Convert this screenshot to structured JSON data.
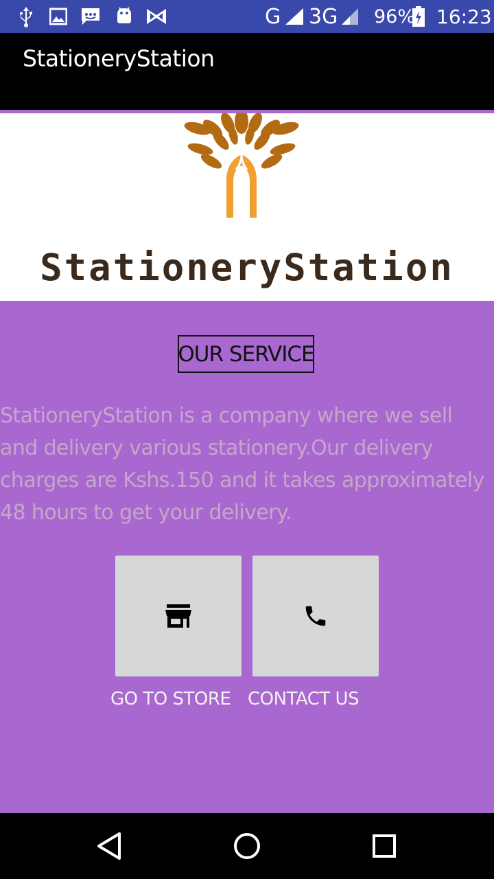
{
  "status_bar": {
    "network": "G",
    "network2": "3G",
    "battery": "96%",
    "time": "16:23",
    "icons": [
      "usb-icon",
      "image-icon",
      "message-icon",
      "android-icon",
      "bowtie-icon",
      "signal-icon",
      "battery-icon"
    ]
  },
  "app_bar": {
    "title": "StationeryStation"
  },
  "header": {
    "brand": "StationeryStation"
  },
  "service": {
    "heading": "OUR SERVICE",
    "description": "StationeryStation is a company where we sell and delivery various stationery.Our delivery charges are Kshs.150 and it takes approximately 48 hours to get your delivery."
  },
  "actions": {
    "store_label": "GO TO STORE",
    "contact_label": "CONTACT US"
  },
  "colors": {
    "status_bar": "#3949ab",
    "app_bar": "#000000",
    "background": "#a967d0",
    "tile": "#d6d7d7",
    "logo_leaves": "#b36b12",
    "logo_trunk": "#f0a030"
  }
}
